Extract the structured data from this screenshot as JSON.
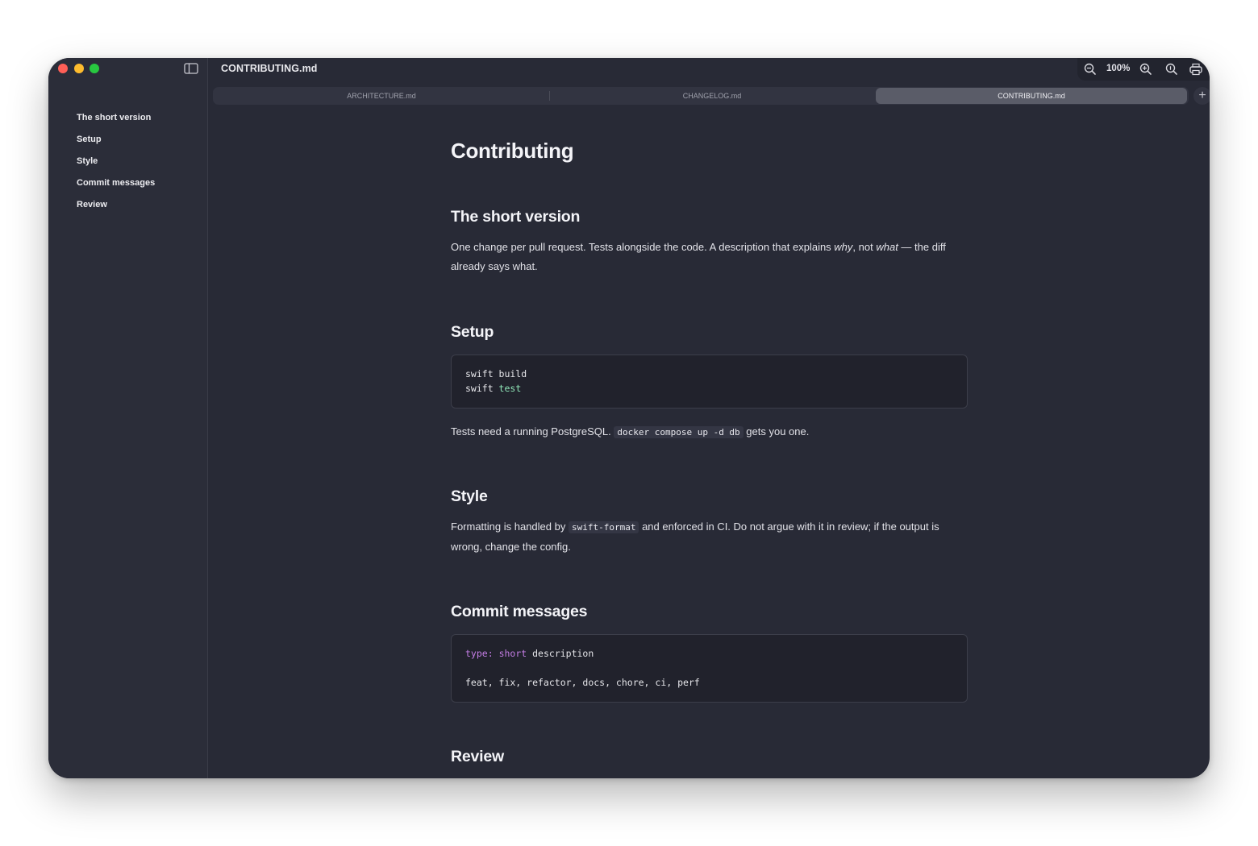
{
  "window": {
    "title": "CONTRIBUTING.md",
    "zoom": "100%"
  },
  "tabs": [
    {
      "label": "ARCHITECTURE.md",
      "active": false
    },
    {
      "label": "CHANGELOG.md",
      "active": false
    },
    {
      "label": "CONTRIBUTING.md",
      "active": true
    }
  ],
  "new_tab_label": "+",
  "toc": [
    "The short version",
    "Setup",
    "Style",
    "Commit messages",
    "Review"
  ],
  "doc": {
    "title": "Contributing",
    "sections": {
      "short": {
        "heading": "The short version",
        "p1": "One change per pull request. Tests alongside the code. A description that explains ",
        "em_why": "why",
        "p2": ", not ",
        "em_what": "what",
        "p3": " — the diff already says what."
      },
      "setup": {
        "heading": "Setup",
        "code_line1": "swift build",
        "code_line2_cmd": "swift ",
        "code_line2_arg": "test",
        "p1": "Tests need a running PostgreSQL. ",
        "inline_code": "docker compose up -d db",
        "p2": " gets you one."
      },
      "style": {
        "heading": "Style",
        "p1": "Formatting is handled by ",
        "inline_code": "swift-format",
        "p2": " and enforced in CI. Do not argue with it in review; if the output is wrong, change the config."
      },
      "commit": {
        "heading": "Commit messages",
        "code_type": "type:",
        "code_short": "short",
        "code_desc": "description",
        "code_types": "feat, fix, refactor, docs, chore, ci, perf"
      },
      "review": {
        "heading": "Review"
      }
    }
  },
  "colors": {
    "window_bg": "#282a36",
    "sidebar_bg": "#2b2d39",
    "code_bg": "#21222c",
    "accent_green": "#8ee3b6",
    "accent_purple": "#c57ee6"
  }
}
